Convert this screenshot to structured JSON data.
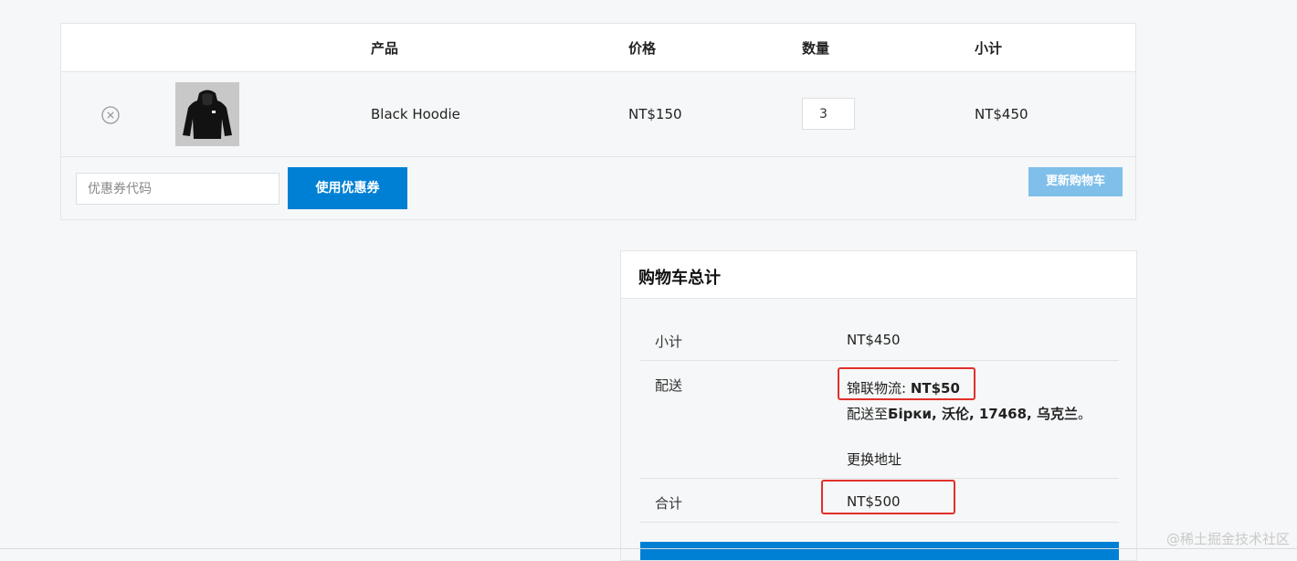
{
  "cart": {
    "headers": {
      "product": "产品",
      "price": "价格",
      "quantity": "数量",
      "subtotal": "小计"
    },
    "items": [
      {
        "name": "Black Hoodie",
        "price": "NT$150",
        "quantity": "3",
        "subtotal": "NT$450"
      }
    ],
    "coupon": {
      "placeholder": "优惠券代码",
      "apply_label": "使用优惠券"
    },
    "update_label": "更新购物车"
  },
  "totals": {
    "title": "购物车总计",
    "subtotal_label": "小计",
    "subtotal_value": "NT$450",
    "shipping_label": "配送",
    "shipping_method": "锦联物流: ",
    "shipping_cost": "NT$50",
    "shipping_dest_prefix": "配送至",
    "shipping_dest": "Бірки, 沃伦, 17468, 乌克兰",
    "shipping_dest_suffix": "。",
    "change_address": "更换地址",
    "total_label": "合计",
    "total_value": "NT$500"
  },
  "watermark": "@稀土掘金技术社区",
  "colors": {
    "accent": "#0080d4",
    "accent_disabled": "#7fbfe9",
    "highlight": "#e0302a"
  },
  "icons": {
    "remove": "circle-x-icon",
    "thumbnail": "hoodie-thumbnail"
  }
}
